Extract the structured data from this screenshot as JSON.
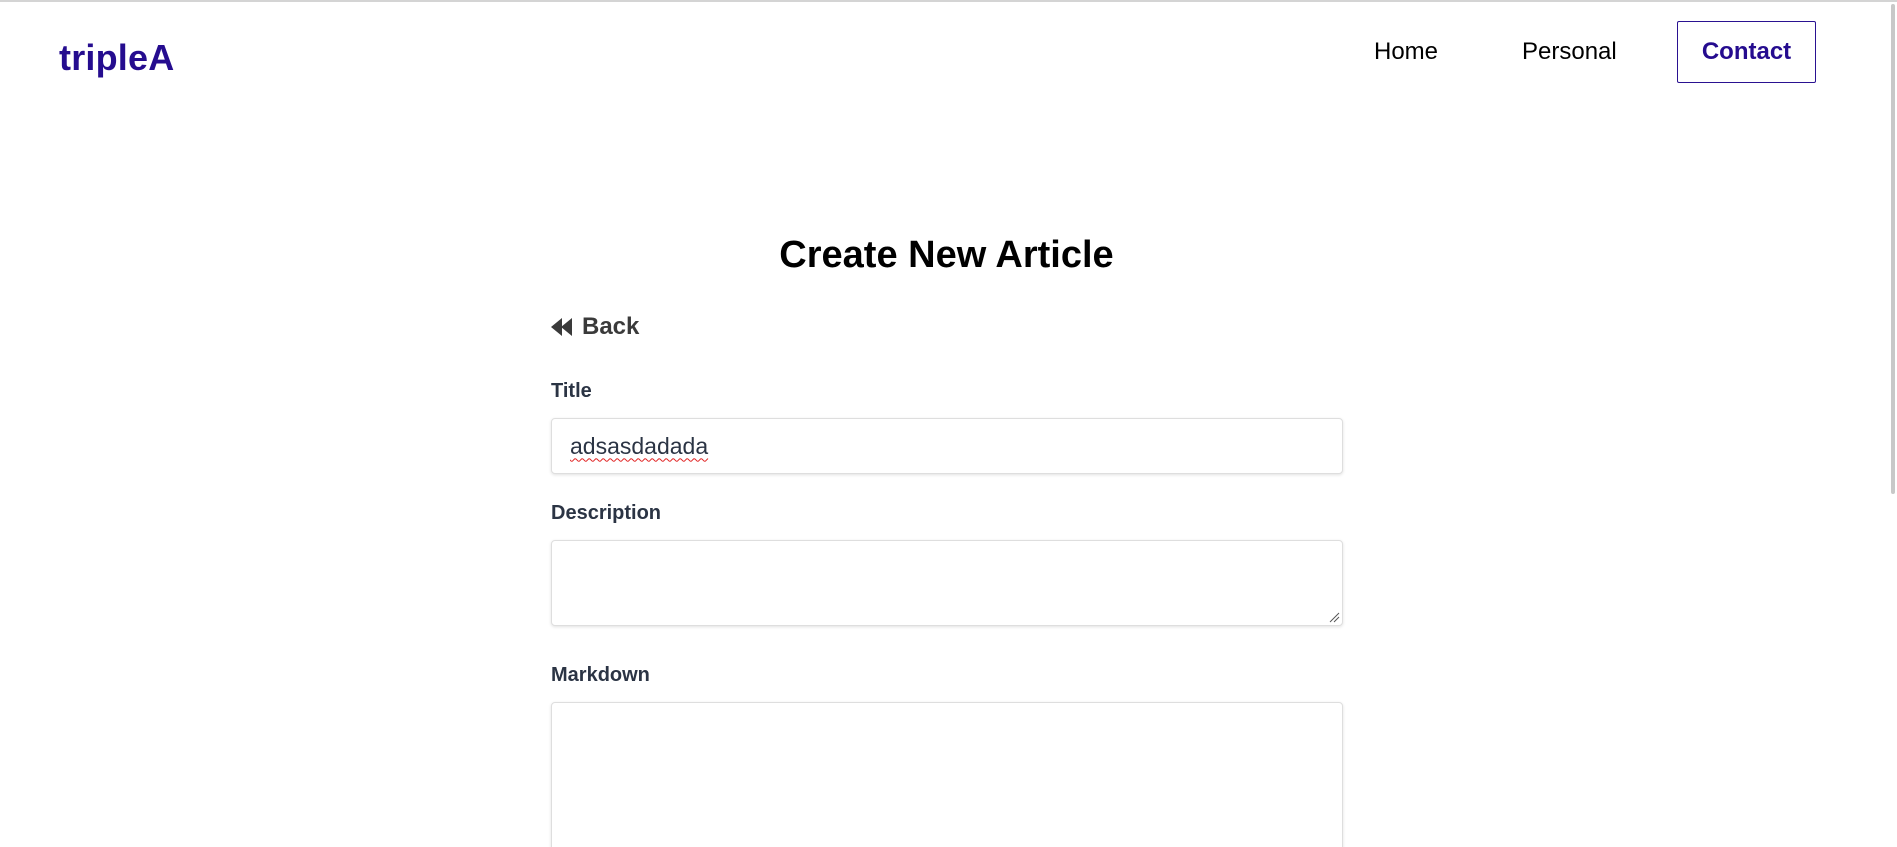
{
  "navbar": {
    "logo": "tripleA",
    "links": [
      {
        "label": "Home"
      },
      {
        "label": "Personal"
      }
    ],
    "contact_label": "Contact"
  },
  "main": {
    "heading": "Create New Article",
    "back_label": "Back",
    "form": {
      "title": {
        "label": "Title",
        "value": "adsasdadada"
      },
      "description": {
        "label": "Description",
        "value": ""
      },
      "markdown": {
        "label": "Markdown",
        "value": ""
      }
    }
  },
  "icons": {
    "back": "backward-icon",
    "resize": "resize-grip-icon"
  },
  "colors": {
    "brand": "#250c8f",
    "label": "#2b3444",
    "misspelling_underline": "#e02020"
  }
}
